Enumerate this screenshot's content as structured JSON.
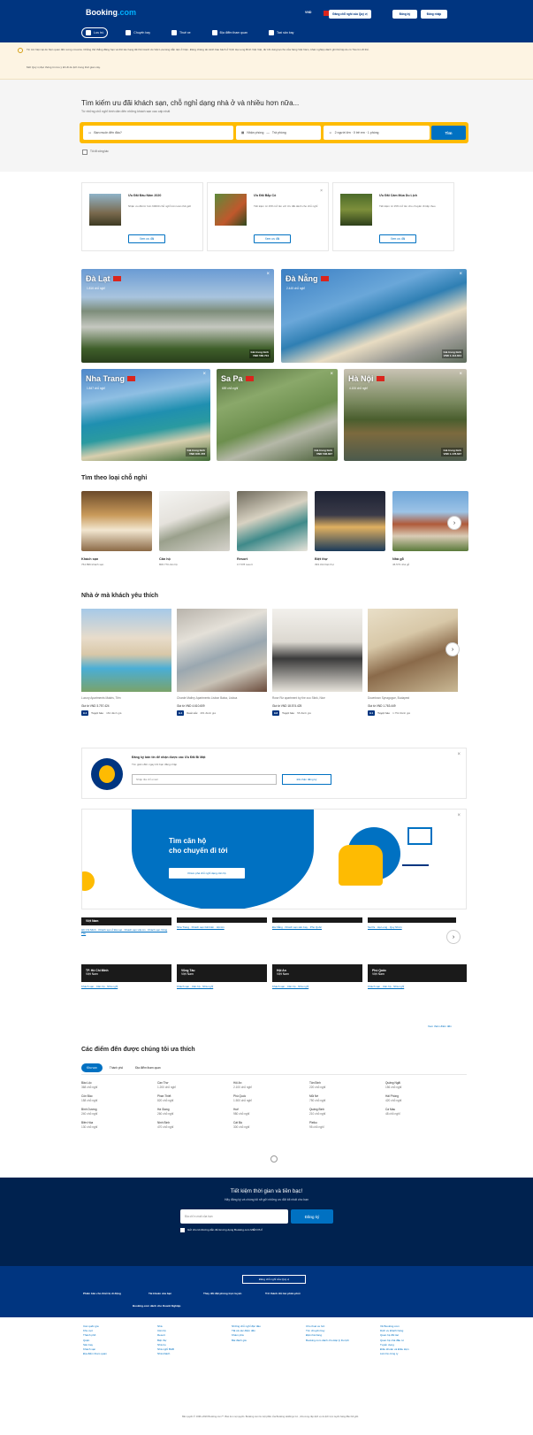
{
  "header": {
    "logo_main": "Booking",
    "logo_suffix": ".com",
    "currency": "VND",
    "list_property": "Đăng chỗ nghỉ của Quý vị",
    "register": "Đăng ký",
    "signin": "Đăng nhập",
    "nav": [
      "Lưu trú",
      "Chuyến bay",
      "Thuê xe",
      "Địa điểm tham quan",
      "Taxi sân bay"
    ]
  },
  "notice": {
    "line1": "Tin tức hiện tại do hiện quan đến sưng covonia. Chẳng thể thẳng đăng hạn và thế tào hạng tất thể ticanh do Việt Lựa tàng dẫn tiện ở hiện. Đảng cháng tài cảnh báo bách ở Vịnh Hạ Long Bình Việt Việt, đư khi dung lại cho của hàng Việt Nam, khác nghiệp dành ghi thể lập do có Tàu tìm đi thể.",
    "line2": "Mời Quý vị đọc thông tin lưu ý khi đi du lịch trong thời gian này."
  },
  "search": {
    "title": "Tìm kiếm ưu đãi khách sạn, chỗ nghỉ dạng nhà ở và nhiều hơn nữa...",
    "subtitle": "Từ những chỗ nghỉ bình dân đến những khách sạn cao cấp nhất",
    "destination_placeholder": "Bạn muốn đến đâu?",
    "checkin": "Nhận phòng",
    "checkout": "Trả phòng",
    "guests": "2 người lớn · 0 trẻ em · 1 phòng",
    "button": "Tìm",
    "business": "Tôi đi công tác"
  },
  "deals": [
    {
      "title": "Ưu Đãi Đầu Năm 2020",
      "desc": "Nhận ưu đãi từ hơn 60000 chỗ nghỉ trên toàn thế giới",
      "btn": "Xem ưu đãi"
    },
    {
      "title": "Ưu Đãi Bắp Cỏ",
      "desc": "Tiết kiệm từ 15% trở lên với Ưu đãi dành cho chỗ nghỉ",
      "btn": "Xem ưu đãi"
    },
    {
      "title": "Ưu Đãi Cảm Mùa Du Lịch",
      "desc": "Tiết kiệm từ 15% trở lên cho chuyến đi tiếp theo",
      "btn": "Xem ưu đãi"
    }
  ],
  "destinations": [
    {
      "name": "Đà Lạt",
      "count": "1.816 chỗ nghỉ",
      "price_lbl": "Giá trung bình",
      "price": "VND 580.704"
    },
    {
      "name": "Đà Nẵng",
      "count": "2.445 chỗ nghỉ",
      "price_lbl": "Giá trung bình",
      "price": "VND 1.113.844"
    },
    {
      "name": "Nha Trang",
      "count": "1.847 chỗ nghỉ",
      "price_lbl": "Giá trung bình",
      "price": "VND 845.478"
    },
    {
      "name": "Sa Pa",
      "count": "659 chỗ nghỉ",
      "price_lbl": "Giá trung bình",
      "price": "VND 536.837"
    },
    {
      "name": "Hà Nội",
      "count": "4.106 chỗ nghỉ",
      "price_lbl": "Giá trung bình",
      "price": "VND 1.178.637"
    }
  ],
  "types": {
    "title": "Tìm theo loại chỗ nghỉ",
    "items": [
      {
        "name": "Khách sạn",
        "count": "764.896 khách sạn"
      },
      {
        "name": "Căn hộ",
        "count": "806.770 căn hộ"
      },
      {
        "name": "Resort",
        "count": "17.578 resort"
      },
      {
        "name": "Biệt thự",
        "count": "393.314 biệt thự"
      },
      {
        "name": "Nhà gỗ",
        "count": "46.573 nhà gỗ"
      }
    ]
  },
  "homes": {
    "title": "Nhà ở mà khách yêu thích",
    "items": [
      {
        "name": "Luxury Apartments Makris, Tiên",
        "price": "Giá từ VND 3.757.424",
        "score": "9.4",
        "label": "Tuyệt hảo",
        "reviews": "184 đánh giá"
      },
      {
        "name": "Charde Malhry Apartments Lisbon Baixa, Lisboa",
        "price": "Giá từ VND 4.610.609",
        "score": "9.4",
        "label": "Xuất sắc",
        "reviews": "281 đánh giá"
      },
      {
        "name": "Rose Riz apartment by the zoo Stink, Nice",
        "price": "Giá từ VND 18.574.425",
        "score": "9.8",
        "label": "Tuyệt hảo",
        "reviews": "58 đánh giá"
      },
      {
        "name": "Downtown Synagogue, Budapest",
        "price": "Giá từ VND 1.763.449",
        "score": "9.1",
        "label": "Tuyệt hảo",
        "reviews": "1.752 đánh giá"
      }
    ]
  },
  "subscribe": {
    "title": "Đăng ký bản tin để nhận được các Ưu Đãi Bí Mật",
    "subtitle": "Tìm giảm đến ngay khi bạn đăng nhập",
    "placeholder": "Nhập địa chỉ email",
    "button": "Đã nhận đăng ký"
  },
  "promo": {
    "title_line1": "Tìm căn hộ",
    "title_line2": "cho chuyến đi tới",
    "button": "Khám phá chỗ nghỉ dạng căn hộ"
  },
  "cities": [
    {
      "name": "Việt Nam",
      "links": "Hồ Chí Minh · Khách sạn ở Đà Lạt · Khách sạn Hội An · Khách sạn Vũng Tàu"
    },
    {
      "name": "",
      "links": "Nha Trang · Khách sạn bãi biển · Hội An"
    },
    {
      "name": "",
      "links": "Đà Nẵng · Khách sạn sân bay · Phú Quốc"
    },
    {
      "name": "",
      "links": "Sa Pa · Hạ Long · Quy Nhơn"
    },
    {
      "name": "TP. Hồ Chí Minh",
      "sub": "Việt Nam",
      "links": "Khách sạn · Căn hộ · Nhà nghỉ"
    },
    {
      "name": "Vũng Tàu",
      "sub": "Việt Nam",
      "links": "Khách sạn · Căn hộ · Nhà nghỉ"
    },
    {
      "name": "Hội An",
      "sub": "Việt Nam",
      "links": "Khách sạn · Căn hộ · Nhà nghỉ"
    },
    {
      "name": "Phú Quốc",
      "sub": "Việt Nam",
      "links": "Khách sạn · Căn hộ · Nhà nghỉ"
    }
  ],
  "more_dest": "Xem thêm điểm đến",
  "favorites": {
    "title": "Các điểm đến được chúng tôi ưa thích",
    "tabs": [
      "Khu vực",
      "Thành phố",
      "Địa điểm tham quan"
    ],
    "items": [
      {
        "n": "Bảo Lộc",
        "c": "368 chỗ nghỉ"
      },
      {
        "n": "Cần Thơ",
        "c": "1.200 chỗ nghỉ"
      },
      {
        "n": "Hội An",
        "c": "2.100 chỗ nghỉ"
      },
      {
        "n": "Tân Định",
        "c": "220 chỗ nghỉ"
      },
      {
        "n": "Quảng Ngãi",
        "c": "156 chỗ nghỉ"
      },
      {
        "n": "Côn Đảo",
        "c": "158 chỗ nghỉ"
      },
      {
        "n": "Phan Thiết",
        "c": "820 chỗ nghỉ"
      },
      {
        "n": "Phú Quốc",
        "c": "1.500 chỗ nghỉ"
      },
      {
        "n": "Mũi Né",
        "c": "750 chỗ nghỉ"
      },
      {
        "n": "Hải Phòng",
        "c": "420 chỗ nghỉ"
      },
      {
        "n": "Bình Dương",
        "c": "240 chỗ nghỉ"
      },
      {
        "n": "Hà Giang",
        "c": "260 chỗ nghỉ"
      },
      {
        "n": "Huế",
        "c": "980 chỗ nghỉ"
      },
      {
        "n": "Quảng Bình",
        "c": "210 chỗ nghỉ"
      },
      {
        "n": "Cà Mau",
        "c": "48 chỗ nghỉ"
      },
      {
        "n": "Biên Hòa",
        "c": "130 chỗ nghỉ"
      },
      {
        "n": "Ninh Bình",
        "c": "470 chỗ nghỉ"
      },
      {
        "n": "Cát Bà",
        "c": "300 chỗ nghỉ"
      },
      {
        "n": "Pleiku",
        "c": "95 chỗ nghỉ"
      }
    ]
  },
  "newsletter": {
    "title": "Tiết kiệm thời gian và tiền bạc!",
    "subtitle": "Hãy đăng ký và chúng tôi sẽ gửi những ưu đãi tốt nhất cho bạn",
    "placeholder": "Địa chỉ e-mail của bạn",
    "button": "Đăng ký",
    "check": "Gửi cho tôi đường dẫn để tải ứng dụng Booking.com MIỄN PHÍ"
  },
  "footer": {
    "list_btn": "Đăng chỗ nghỉ của Quý vị",
    "links1": [
      "Phiên bản cho thiết bị di động",
      "Tài khoản của bạn",
      "Thay đổi đặt phòng trực tuyến",
      "Trở thành đối tác phân phối",
      "Booking.com dành cho Doanh Nghiệp"
    ],
    "cols": [
      [
        "Các quốc gia",
        "Khu vực",
        "Thành phố",
        "Quận",
        "Sân bay",
        "Khách sạn",
        "Địa điểm tham quan"
      ],
      [
        "Nhà",
        "Căn hộ",
        "Resort",
        "Biệt thự",
        "Nhà trọ",
        "Nhà nghỉ B&B",
        "Nhà khách"
      ],
      [
        "Những chỗ nghỉ độc đáo",
        "Tất cả các điểm đến",
        "Khám phá",
        "Bài đánh giá"
      ],
      [
        "Cho thuê xe hơi",
        "Tìm chuyến bay",
        "Đặt nhà hàng",
        "Booking.com dành cho Đại lý Du lịch"
      ],
      [
        "Về Booking.com",
        "Dịch vụ khách hàng",
        "Quan hệ đối tác",
        "Quan hệ nhà đầu tư",
        "Tuyển dụng",
        "Điều khoản và Điều kiện",
        "Liên hệ công ty"
      ]
    ],
    "legal": "Bản quyền © 1996–2020 Booking.com™. Bảo lưu mọi quyền. Booking.com là một phần của Booking Holdings Inc., nhà cung cấp dịch vụ du lịch trực tuyến hàng đầu thế giới."
  },
  "colors": {
    "brand": "#003580",
    "accent": "#0071c2",
    "search": "#febb02"
  }
}
